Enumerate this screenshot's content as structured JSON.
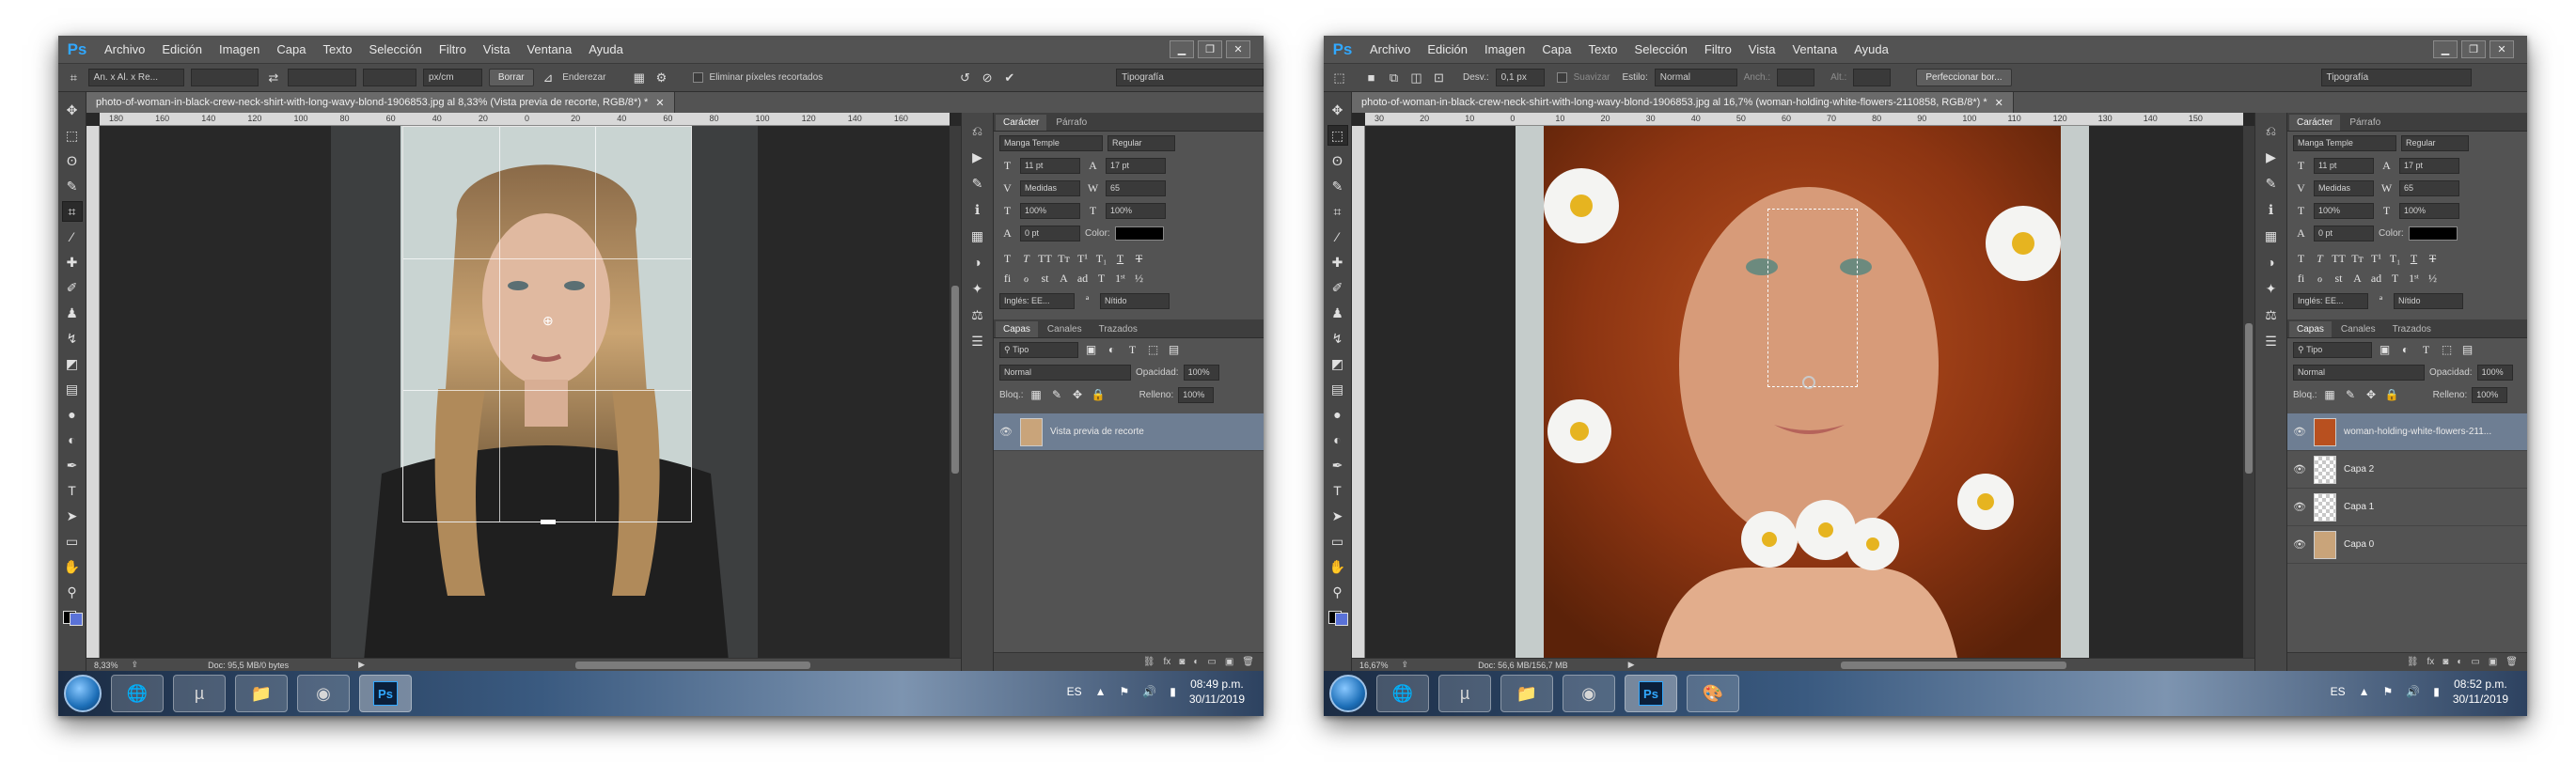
{
  "menu": [
    "Archivo",
    "Edición",
    "Imagen",
    "Capa",
    "Texto",
    "Selección",
    "Filtro",
    "Vista",
    "Ventana",
    "Ayuda"
  ],
  "shot1": {
    "opt": {
      "ratio": "An. x Al. x Re...",
      "unit": "px/cm",
      "clear_btn": "Borrar",
      "straighten": "Enderezar",
      "delete_cropped": "Eliminar píxeles recortados",
      "workspace": "Tipografía"
    },
    "doc_tab": "photo-of-woman-in-black-crew-neck-shirt-with-long-wavy-blond-1906853.jpg al 8,33% (Vista previa de recorte, RGB/8*) *",
    "ruler_h": [
      "180",
      "160",
      "140",
      "120",
      "100",
      "80",
      "60",
      "40",
      "20",
      "0",
      "20",
      "40",
      "60",
      "80",
      "100",
      "120",
      "140",
      "160"
    ],
    "zoom": "8,33%",
    "doc_size": "Doc: 95,5 MB/0 bytes",
    "char": {
      "tab1": "Carácter",
      "tab2": "Párrafo",
      "font": "Manga Temple",
      "style": "Regular",
      "size": "11 pt",
      "leading": "17 pt",
      "kerning": "Medidas",
      "tracking": "65",
      "vscale": "100%",
      "hscale": "100%",
      "baseline": "0 pt",
      "color_label": "Color:",
      "lang": "Inglés: EE...",
      "aa": "Nítido"
    },
    "layers": {
      "tab1": "Capas",
      "tab2": "Canales",
      "tab3": "Trazados",
      "filter": "Tipo",
      "blend": "Normal",
      "opacity_label": "Opacidad:",
      "opacity": "100%",
      "lock_label": "Bloq.:",
      "fill_label": "Relleno:",
      "fill": "100%",
      "items": [
        {
          "name": "Vista previa de recorte"
        }
      ]
    },
    "clock_time": "08:49 p.m.",
    "clock_date": "30/11/2019",
    "lang": "ES"
  },
  "shot2": {
    "opt": {
      "feather_label": "Desv.:",
      "feather": "0,1 px",
      "smooth": "Suavizar",
      "style_label": "Estilo:",
      "style": "Normal",
      "width_label": "Anch.:",
      "height_label": "Alt.:",
      "refine": "Perfeccionar bor...",
      "workspace": "Tipografía"
    },
    "doc_tab": "photo-of-woman-in-black-crew-neck-shirt-with-long-wavy-blond-1906853.jpg al 16,7% (woman-holding-white-flowers-2110858, RGB/8*) *",
    "ruler_h": [
      "30",
      "20",
      "10",
      "0",
      "10",
      "20",
      "30",
      "40",
      "50",
      "60",
      "70",
      "80",
      "90",
      "100",
      "110",
      "120",
      "130",
      "140",
      "150"
    ],
    "zoom": "16,67%",
    "doc_size": "Doc: 56,6 MB/156,7 MB",
    "char": {
      "tab1": "Carácter",
      "tab2": "Párrafo",
      "font": "Manga Temple",
      "style": "Regular",
      "size": "11 pt",
      "leading": "17 pt",
      "kerning": "Medidas",
      "tracking": "65",
      "vscale": "100%",
      "hscale": "100%",
      "baseline": "0 pt",
      "color_label": "Color:",
      "lang": "Inglés: EE...",
      "aa": "Nítido"
    },
    "layers": {
      "tab1": "Capas",
      "tab2": "Canales",
      "tab3": "Trazados",
      "filter": "Tipo",
      "blend": "Normal",
      "opacity_label": "Opacidad:",
      "opacity": "100%",
      "lock_label": "Bloq.:",
      "fill_label": "Relleno:",
      "fill": "100%",
      "items": [
        {
          "name": "woman-holding-white-flowers-211..."
        },
        {
          "name": "Capa 2"
        },
        {
          "name": "Capa 1"
        },
        {
          "name": "Capa 0"
        }
      ]
    },
    "clock_time": "08:52 p.m.",
    "clock_date": "30/11/2019",
    "lang": "ES"
  }
}
